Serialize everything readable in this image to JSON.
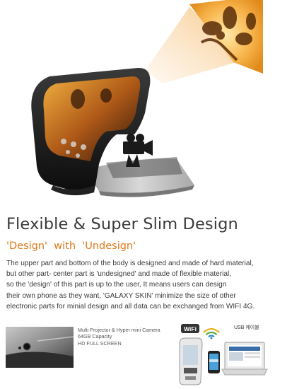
{
  "headline": "Flexible & Super Slim Design",
  "subhead": "'Design'  with  'Undesign'",
  "body_lines": [
    "The upper part and bottom of the body is designed and made of hard material,",
    "but other part- center part is 'undesigned' and made of  flexible material,",
    "so the 'design' of this part is up to the user, It means users can design",
    "their own phone as they want, 'GALAXY SKIN' minimize the size of other",
    "electronic parts for minial design and all data can be exchanged from WIFI 4G."
  ],
  "features": {
    "line1": "Multi Projector & Hyper mini Camera",
    "line2": "64GB Capacity",
    "line3": "HD FULL SCREEN"
  },
  "badges": {
    "wifi": "WiFi",
    "usb": "USB 케이블"
  },
  "colors": {
    "accent": "#e07818",
    "text": "#3a3a3a",
    "device_dark": "#1c1c1c"
  }
}
